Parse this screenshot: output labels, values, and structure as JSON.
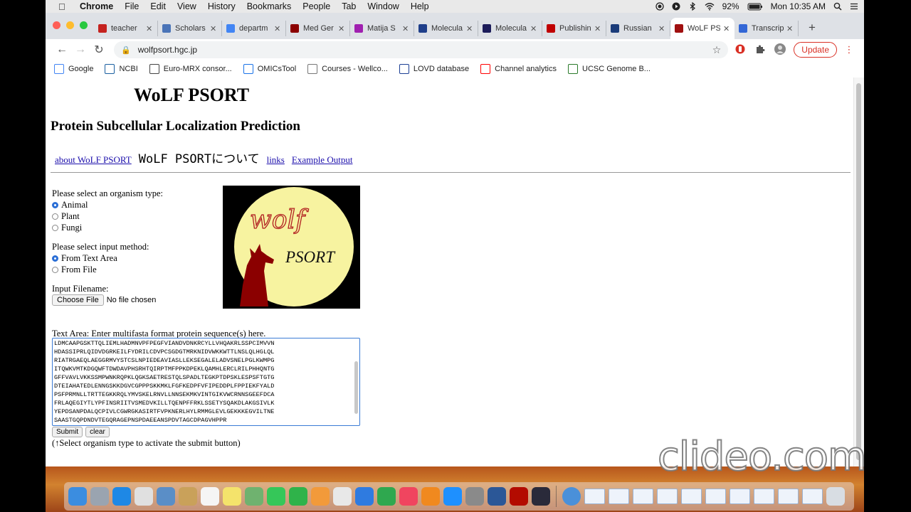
{
  "menubar": {
    "app": "Chrome",
    "items": [
      "File",
      "Edit",
      "View",
      "History",
      "Bookmarks",
      "People",
      "Tab",
      "Window",
      "Help"
    ],
    "battery": "92%",
    "clock": "Mon 10:35 AM"
  },
  "tabs": [
    {
      "title": "teacher",
      "icon": "google-icon",
      "color": "#c5221f"
    },
    {
      "title": "Scholars",
      "icon": "scholars-icon",
      "color": "#4a74b8"
    },
    {
      "title": "departm",
      "icon": "google-icon",
      "color": "#4285f4"
    },
    {
      "title": "Med Ger",
      "icon": "shield-icon",
      "color": "#8b0000"
    },
    {
      "title": "Matija S",
      "icon": "plus-circle-icon",
      "color": "#a020b0"
    },
    {
      "title": "Molecula",
      "icon": "journal-icon",
      "color": "#1f3f8a"
    },
    {
      "title": "Molecula",
      "icon": "m-icon",
      "color": "#1c1c5a"
    },
    {
      "title": "Publishin",
      "icon": "grid-icon",
      "color": "#c00000"
    },
    {
      "title": "Russian",
      "icon": "chart-icon",
      "color": "#1b3c7a"
    },
    {
      "title": "WoLF PS",
      "icon": "wolf-icon",
      "color": "#a01010",
      "active": true
    },
    {
      "title": "Transcrip",
      "icon": "link-icon",
      "color": "#3367d6"
    }
  ],
  "toolbar": {
    "url": "wolfpsort.hgc.jp",
    "update_label": "Update"
  },
  "bookmarks": [
    {
      "label": "Google",
      "icon": "google-icon"
    },
    {
      "label": "NCBI",
      "icon": "ncbi-icon"
    },
    {
      "label": "Euro-MRX consor...",
      "icon": "globe-icon"
    },
    {
      "label": "OMICsTool",
      "icon": "omics-icon"
    },
    {
      "label": "Courses - Wellco...",
      "icon": "globe-icon"
    },
    {
      "label": "LOVD database",
      "icon": "lovd-icon"
    },
    {
      "label": "Channel analytics",
      "icon": "youtube-icon"
    },
    {
      "label": "UCSC Genome B...",
      "icon": "ucsc-icon"
    }
  ],
  "page": {
    "title": "WoLF PSORT",
    "subtitle": "Protein Subcellular Localization Prediction",
    "links": [
      "about WoLF PSORT",
      "WoLF PSORTについて",
      "links",
      "Example Output"
    ],
    "organism_label": "Please select an organism type:",
    "organisms": [
      "Animal",
      "Plant",
      "Fungi"
    ],
    "organism_selected": "Animal",
    "input_method_label": "Please select input method:",
    "input_methods": [
      "From Text Area",
      "From File"
    ],
    "input_method_selected": "From Text Area",
    "filename_label": "Input Filename:",
    "choose_file_label": "Choose File",
    "no_file_label": "No file chosen",
    "logo_text_top": "wolf",
    "logo_text_bottom": "PSORT",
    "textarea_label": "Text Area: Enter multifasta format protein sequence(s) here.",
    "sequence_lines": [
      "LDMCAAPGSKTTQLIEMLHADMNVPFPEGFVIANDVDNKRCYLLVHQAKRLSSPCIMVVN",
      "HDASSIPRLQIDVDGRKEILFYDRILCDVPCSGDGTMRKNIDVWKKWTTLNSLQLHGLQL",
      "RIATRGAEQLAEGGRMVYSTCSLNPIEDEAVIASLLEKSEGALELADVSNELPGLKWMPG",
      "ITQWKVMTKDGQWFTDWDAVPHSRHTQIRPTMFPPKDPEKLQAMHLERCLRILPHHQNTG",
      "GFFVAVLVKKSSMPWNKRQPKLQGKSAETRESTQLSPADLTEGKPTDPSKLESPSFTGTG",
      "DTEIAHATEDLENNGSKKDGVCGPPPSKKMKLFGFKEDPFVFIPEDDPLFPPIEKFYALD",
      "PSFPRMNLLTRTTEGKKRQLYMVSKELRNVLLNNSEKMKVINTGIKVWCRNNSGEEFDCA",
      "FRLAQEGIYTLYPFINSRIITVSMEDVKILLTQENPFFRKLSSETYSQAKDLAKGSIVLK",
      "YEPDSANPDALQCPIVLCGWRGKASIRTFVPKNERLHYLRMMGLEVLGEKKKEGVILTNE",
      "SAASTGQPDNDVTEGQRAGEPNSPDAEEANSPDVTAGCDPAGVHPPR"
    ],
    "submit_label": "Submit",
    "clear_label": "clear",
    "hint": "(↑Select organism type to activate the submit button)"
  },
  "watermark": "clideo.com",
  "colors": {
    "link": "#1a0dab",
    "logo_circle": "#f7f3a0",
    "wolf": "#8b0000",
    "focus": "#3a7bd5",
    "update": "#d93025"
  }
}
